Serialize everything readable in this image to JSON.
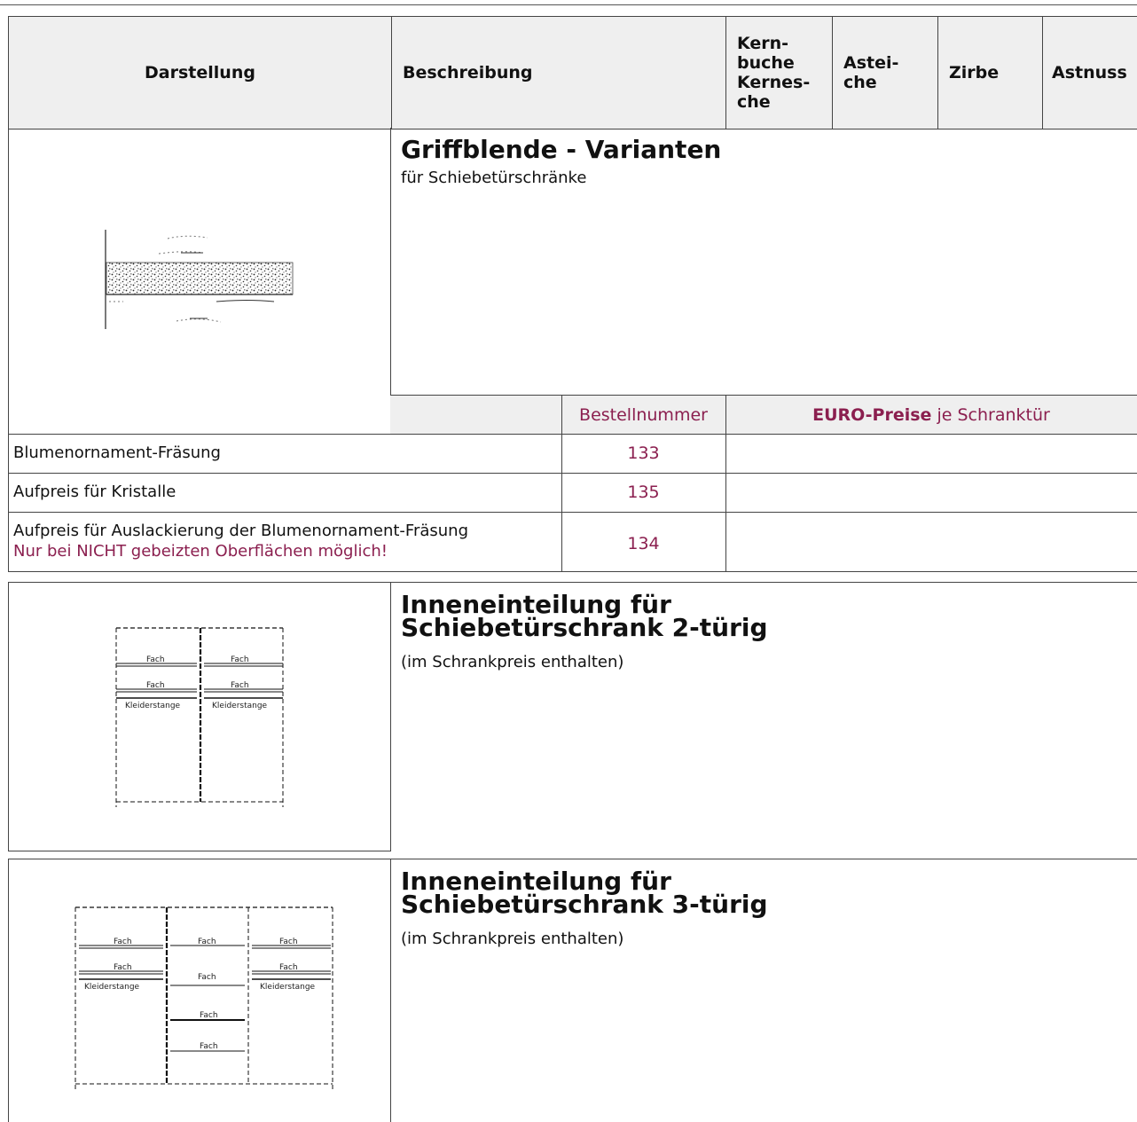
{
  "header": {
    "col_darstellung": "Darstellung",
    "col_beschreibung": "Beschreibung",
    "col_kernbuche": "Kern-\nbuche\nKernes-\nche",
    "col_asteiche": "Astei-\nche",
    "col_zirbe": "Zirbe",
    "col_astnuss": "Astnuss"
  },
  "section1": {
    "title": "Griffblende - Varianten",
    "subtitle": "für Schiebetürschränke",
    "order_header": "Bestellnummer",
    "price_header_bold": "EURO-Preise",
    "price_header_rest": " je Schranktür",
    "rows": [
      {
        "label": "Blumenornament-Fräsung",
        "note": "",
        "number": "133"
      },
      {
        "label": "Aufpreis für Kristalle",
        "note": "",
        "number": "135"
      },
      {
        "label": "Aufpreis für Auslackierung der Blumenornament-Fräsung",
        "note": "Nur bei NICHT gebeizten Oberflächen möglich!",
        "number": "134"
      }
    ]
  },
  "section2": {
    "title": "Inneneinteilung für\nSchiebetürschrank 2-türig",
    "subtitle": "(im Schrankpreis enthalten)",
    "diagram_labels": [
      "Fach",
      "Fach",
      "Fach",
      "Fach",
      "Kleiderstange",
      "Kleiderstange"
    ]
  },
  "section3": {
    "title": "Inneneinteilung für\nSchiebetürschrank 3-türig",
    "subtitle": "(im Schrankpreis enthalten)",
    "diagram_labels": [
      "Fach",
      "Fach",
      "Fach",
      "Fach",
      "Fach",
      "Fach",
      "Kleiderstange",
      "Kleiderstange",
      "Fach",
      "Fach"
    ]
  },
  "colors": {
    "accent": "#8b1f4f",
    "header_bg": "#efefef",
    "border": "#444444"
  }
}
